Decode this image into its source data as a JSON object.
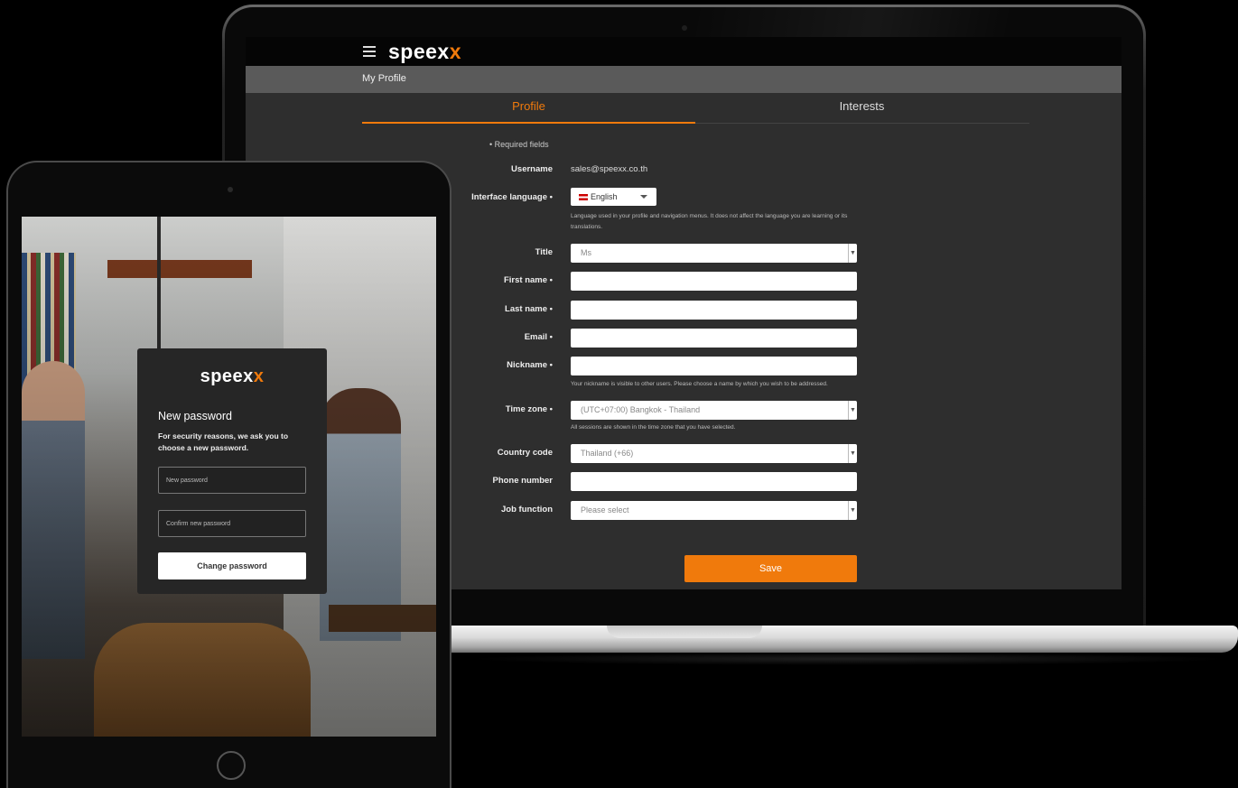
{
  "laptop": {
    "brand_prefix": "speex",
    "brand_accent": "x",
    "breadcrumb": "My Profile",
    "tabs": [
      {
        "label": "Profile",
        "active": true
      },
      {
        "label": "Interests",
        "active": false
      }
    ],
    "required_note": "• Required fields",
    "form": {
      "username": {
        "label": "Username",
        "value": "sales@speexx.co.th"
      },
      "interface_language": {
        "label": "Interface language •",
        "value": "English",
        "hint": "Language used in your profile and navigation menus. It does not affect the language you are learning or its translations."
      },
      "title": {
        "label": "Title",
        "value": "Ms"
      },
      "first_name": {
        "label": "First name •",
        "value": ""
      },
      "last_name": {
        "label": "Last name •",
        "value": ""
      },
      "email": {
        "label": "Email •",
        "value": ""
      },
      "nickname": {
        "label": "Nickname •",
        "value": "",
        "hint": "Your nickname is visible to other users. Please choose a name by which you wish to be addressed."
      },
      "time_zone": {
        "label": "Time zone •",
        "value": "(UTC+07:00) Bangkok - Thailand",
        "hint": "All sessions are shown in the time zone that you have selected."
      },
      "country_code": {
        "label": "Country code",
        "value": "Thailand (+66)"
      },
      "phone_number": {
        "label": "Phone number",
        "value": ""
      },
      "job_function": {
        "label": "Job function",
        "value": "Please select"
      }
    },
    "save_label": "Save"
  },
  "tablet": {
    "brand_prefix": "speex",
    "brand_accent": "x",
    "title": "New password",
    "description": "For security reasons, we ask you to choose a new password.",
    "new_password_placeholder": "New password",
    "confirm_password_placeholder": "Confirm new password",
    "change_button_label": "Change password"
  },
  "colors": {
    "accent": "#f07a0c",
    "topbar": "#050505",
    "subbar": "#5a5a5a",
    "screen_bg": "#2e2e2e",
    "card_bg": "#262626"
  }
}
